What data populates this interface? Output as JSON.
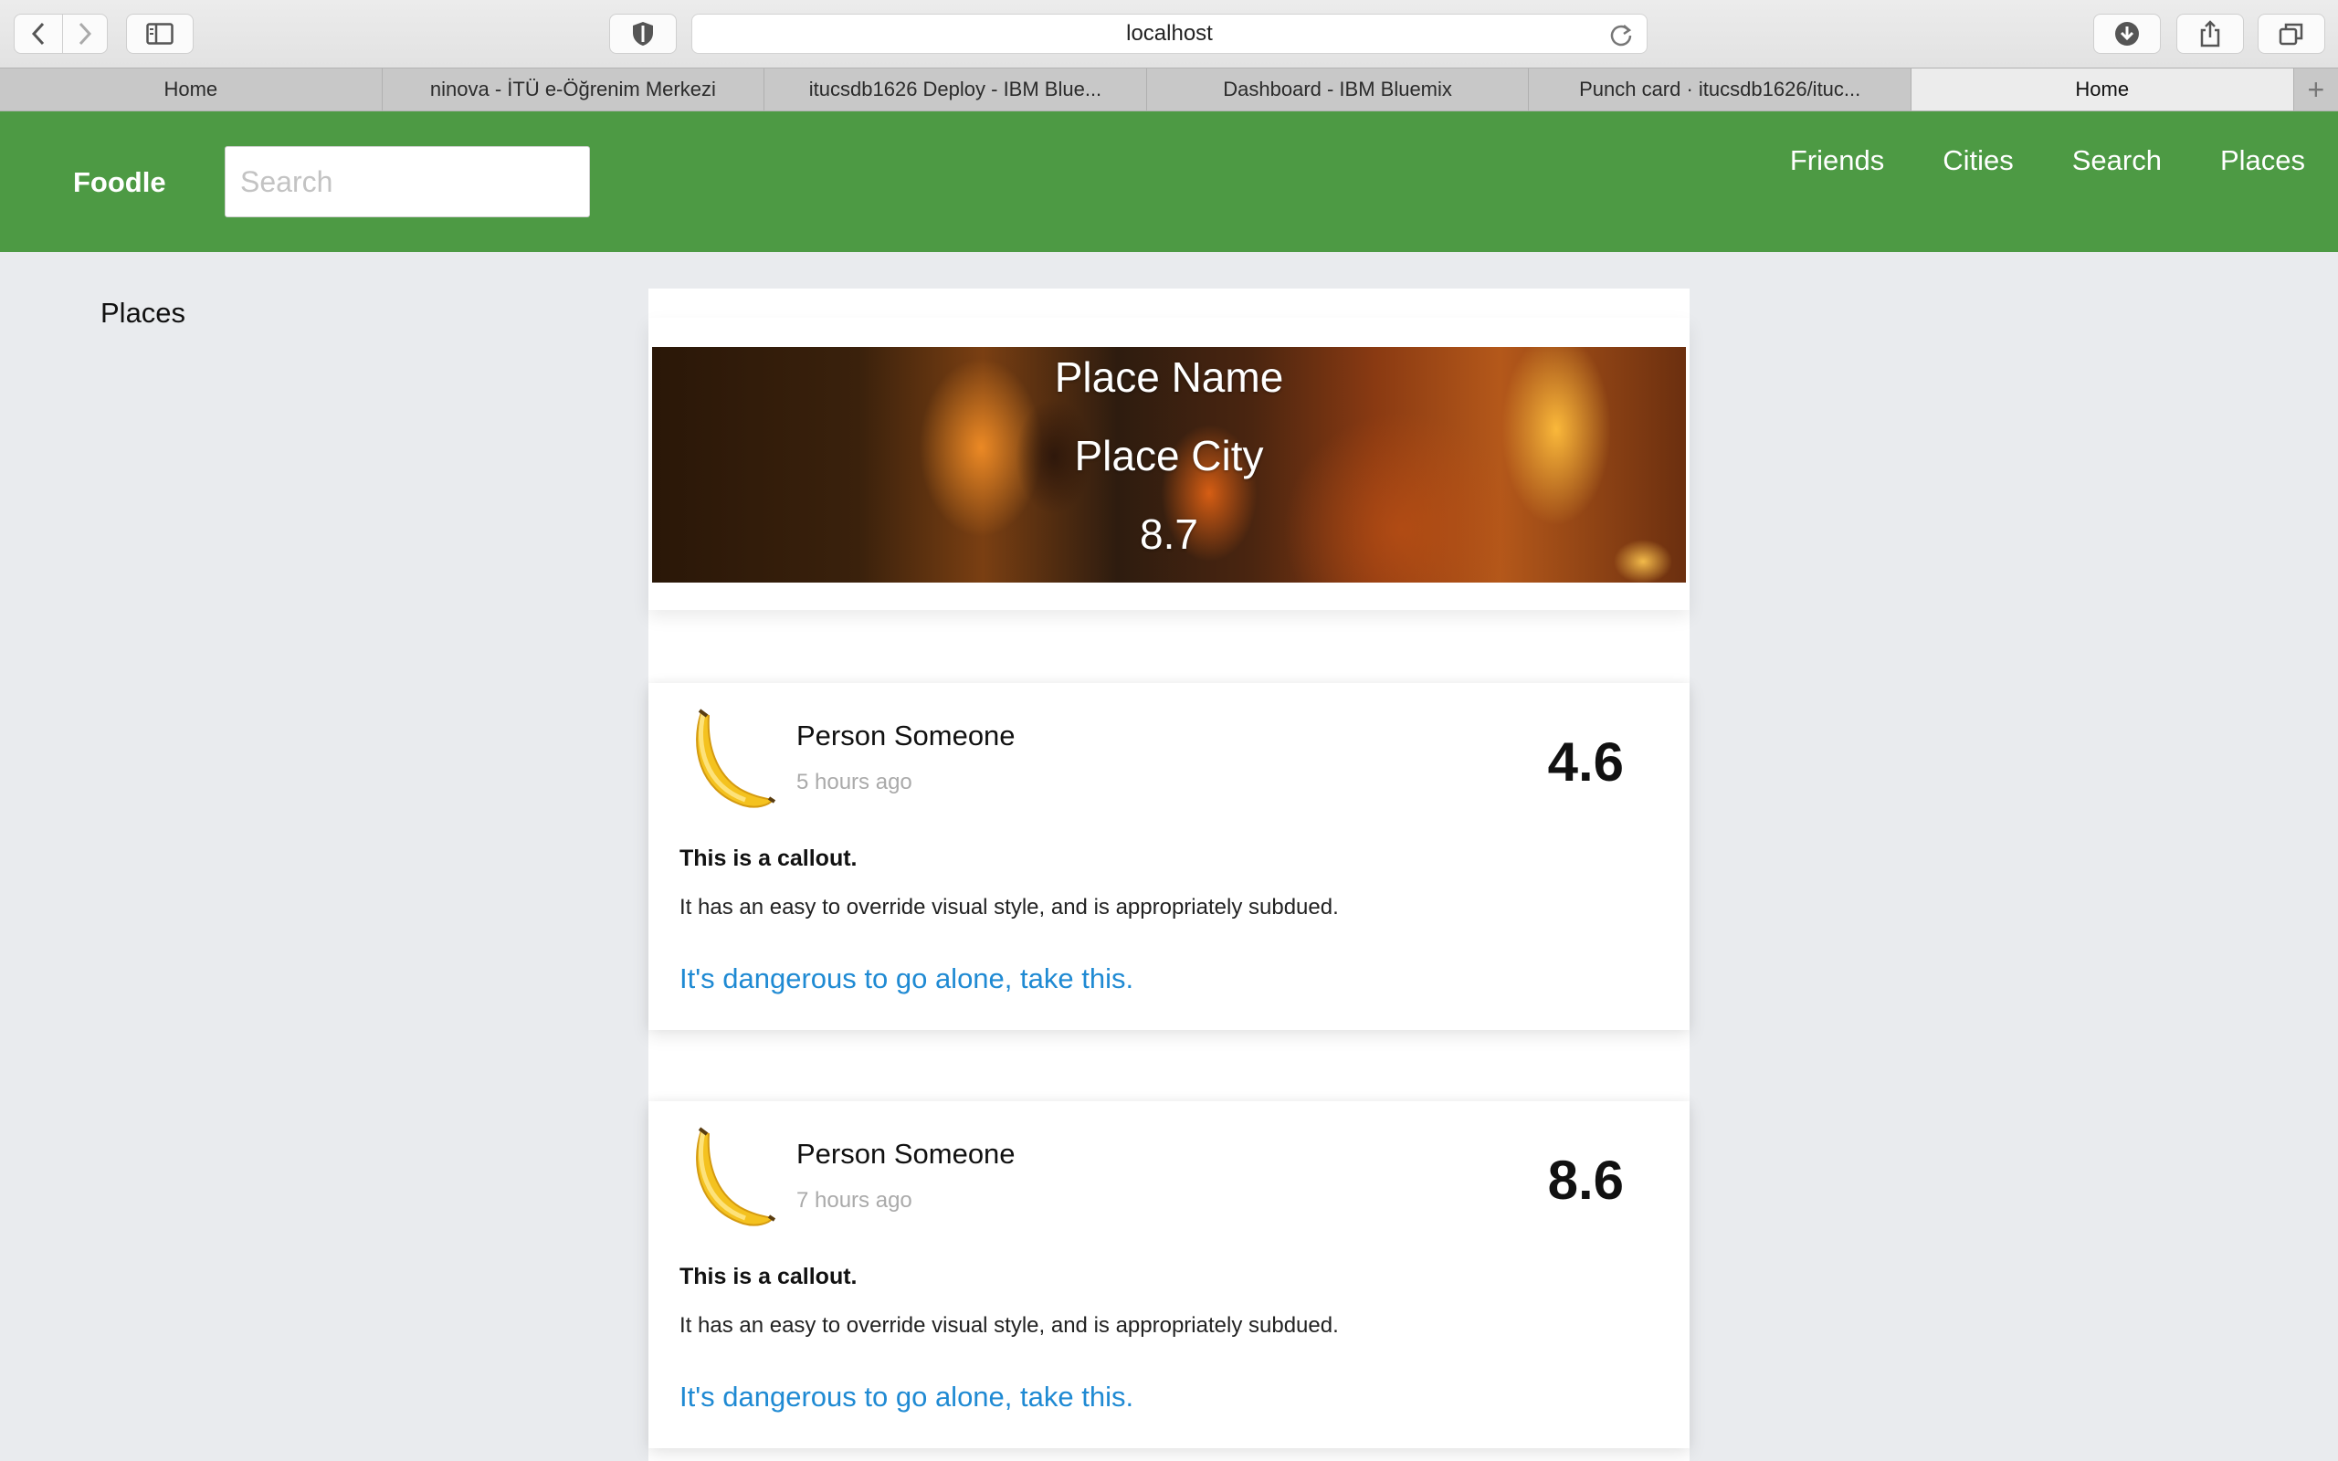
{
  "browser": {
    "url": "localhost",
    "tabs": [
      {
        "label": "Home"
      },
      {
        "label": "ninova - İTÜ e-Öğrenim Merkezi"
      },
      {
        "label": "itucsdb1626 Deploy - IBM Blue..."
      },
      {
        "label": "Dashboard - IBM Bluemix"
      },
      {
        "label": "Punch card · itucsdb1626/ituc..."
      },
      {
        "label": "Home"
      }
    ],
    "new_tab_icon": "plus-icon"
  },
  "header": {
    "brand": "Foodle",
    "search_placeholder": "Search",
    "nav": [
      "Friends",
      "Cities",
      "Search",
      "Places"
    ],
    "color": "#4d9a44"
  },
  "sidebar": {
    "title": "Places"
  },
  "place": {
    "name": "Place Name",
    "city": "Place City",
    "rating": "8.7"
  },
  "reviews": [
    {
      "person": "Person Someone",
      "time": "5 hours ago",
      "score": "4.6",
      "avatar_icon": "banana-icon",
      "callout_title": "This is a callout.",
      "callout_text": "It has an easy to override visual style, and is appropriately subdued.",
      "link": "It's dangerous to go alone, take this."
    },
    {
      "person": "Person Someone",
      "time": "7 hours ago",
      "score": "8.6",
      "avatar_icon": "banana-icon",
      "callout_title": "This is a callout.",
      "callout_text": "It has an easy to override visual style, and is appropriately subdued.",
      "link": "It's dangerous to go alone, take this."
    }
  ],
  "colors": {
    "link": "#1f8ad3",
    "page_bg": "#e9ebee"
  }
}
